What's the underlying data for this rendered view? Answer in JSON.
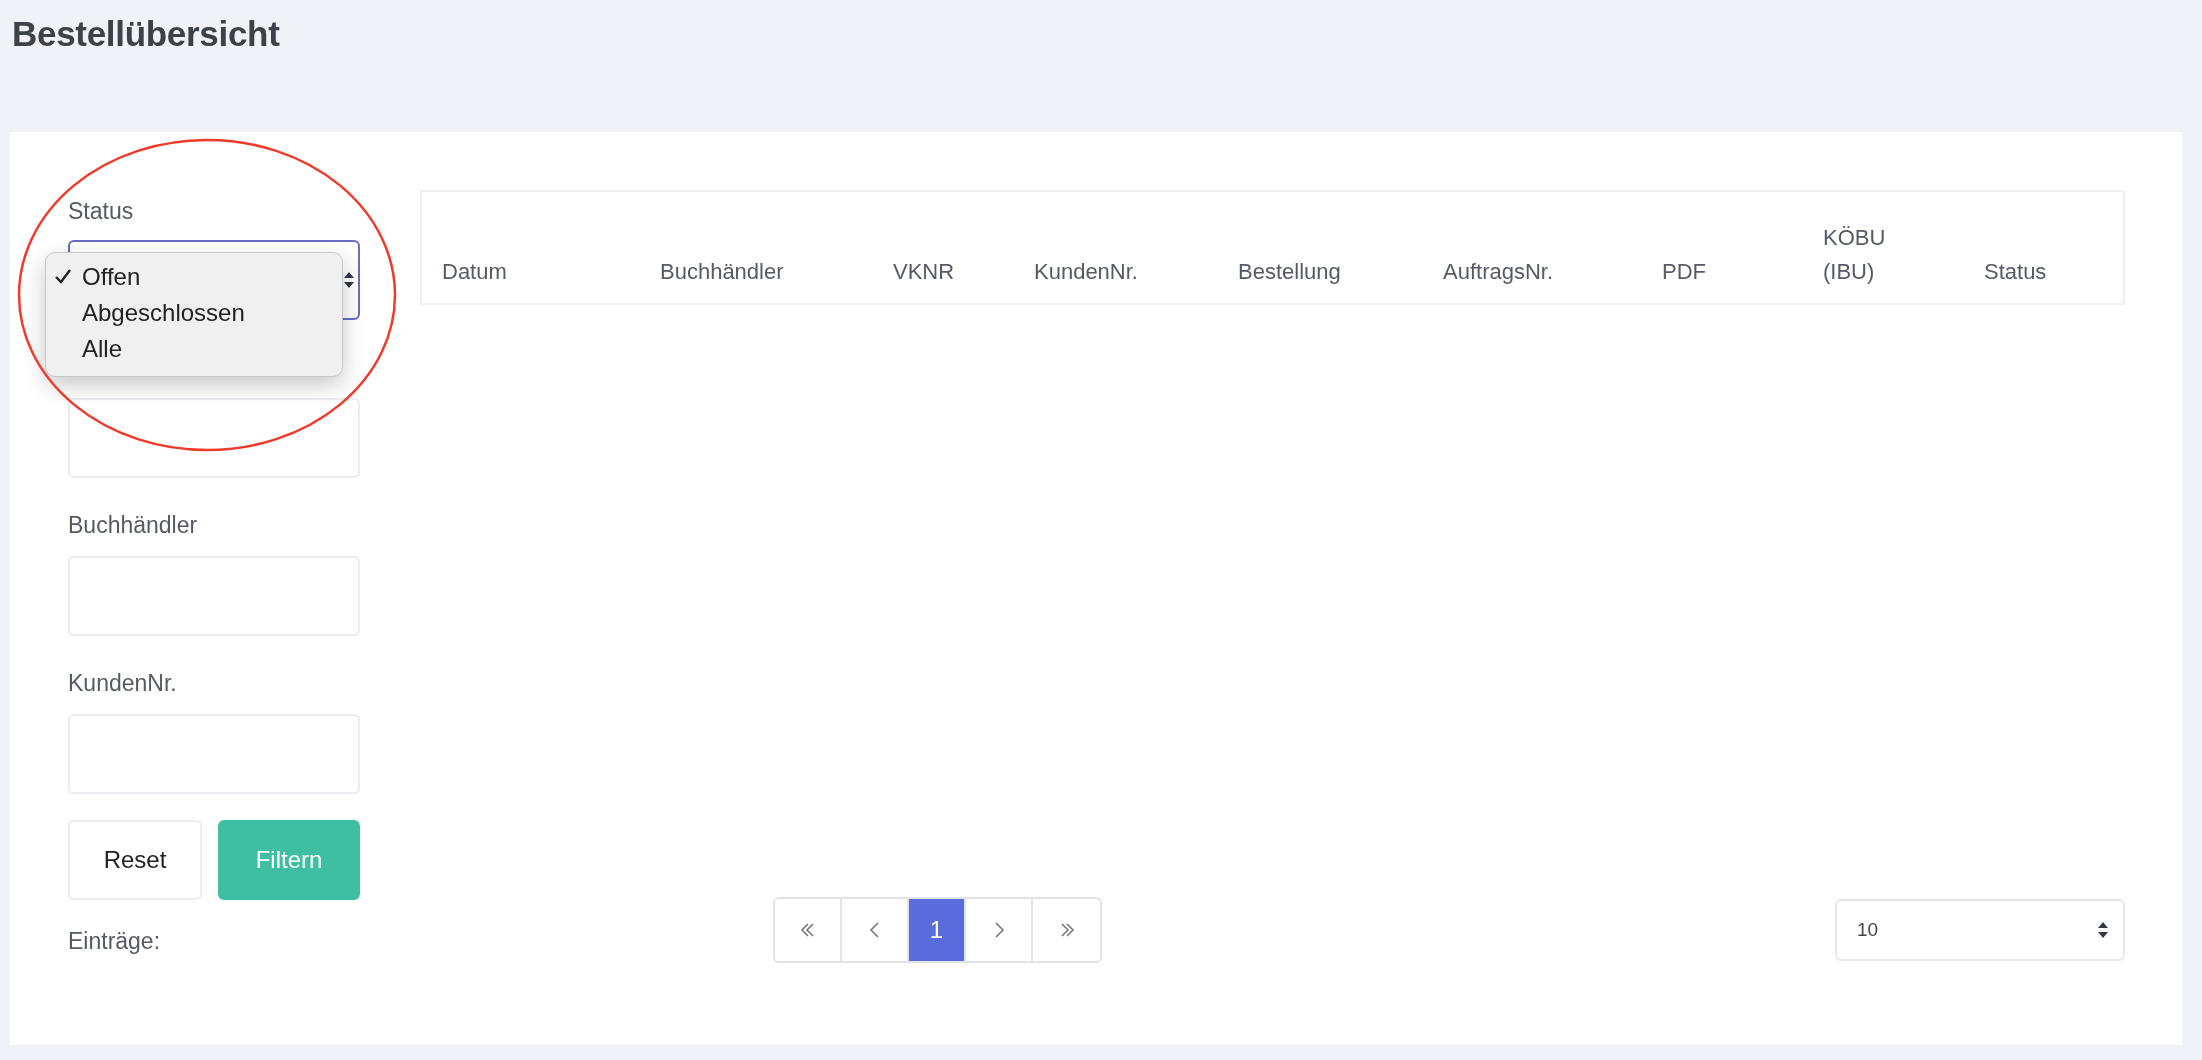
{
  "title": "Bestellübersicht",
  "filters": [
    {
      "label": "Status",
      "kind": "select"
    },
    {
      "kind": "text"
    },
    {
      "label": "Buchhändler",
      "kind": "text"
    },
    {
      "label": "KundenNr.",
      "kind": "text"
    }
  ],
  "status_menu": [
    {
      "label": "Offen",
      "selected": true
    },
    {
      "label": "Abgeschlossen",
      "selected": false
    },
    {
      "label": "Alle",
      "selected": false
    }
  ],
  "buttons": [
    {
      "label": "Reset",
      "kind": "secondary"
    },
    {
      "label": "Filtern",
      "kind": "primary"
    }
  ],
  "entries_label": "Einträge:",
  "table": {
    "columns": [
      "Datum",
      "Buchhändler",
      "VKNR",
      "KundenNr.",
      "Bestellung",
      "AuftragsNr.",
      "PDF",
      "KÖBU (IBU)",
      "Status"
    ]
  },
  "pagination": {
    "pages": [
      {
        "label": "1",
        "selected": true
      }
    ]
  },
  "page_size": "10"
}
